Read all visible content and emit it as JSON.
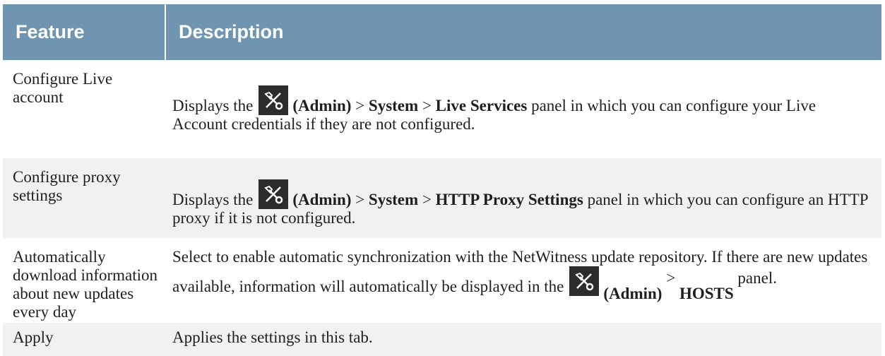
{
  "table": {
    "headers": [
      "Feature",
      "Description"
    ],
    "rows": [
      {
        "feature": "Configure Live account",
        "d_pre": "Displays the",
        "d_admin": "(Admin)",
        "d_gt1": " > ",
        "d_b1": "System",
        "d_gt2": " > ",
        "d_b2": "Live Services",
        "d_post": " panel in which you can configure your Live Account credentials if they are not configured."
      },
      {
        "feature": "Configure proxy settings",
        "d_pre": "Displays the",
        "d_admin": "(Admin)",
        "d_gt1": " > ",
        "d_b1": "System",
        "d_gt2": " > ",
        "d_b2": "HTTP Proxy Settings",
        "d_post": " panel in which you can configure an HTTP proxy if it is not configured."
      },
      {
        "feature": "Automatically download information about new updates every day",
        "d_pre": "Select to enable automatic synchronization with the NetWitness update repository. If there are new updates available, information will automatically be displayed in the",
        "d_admin": "(Admin)",
        "d_gt1": " > ",
        "d_b1": "HOSTS",
        "d_post": " panel."
      },
      {
        "feature": "Apply",
        "description": "Applies the settings in this tab."
      }
    ]
  },
  "icons": {
    "admin": "admin-tools-icon"
  },
  "colors": {
    "header_bg": "#7095b1",
    "stripe_bg": "#f1f1f1",
    "icon_bg": "#2c2c2c"
  }
}
